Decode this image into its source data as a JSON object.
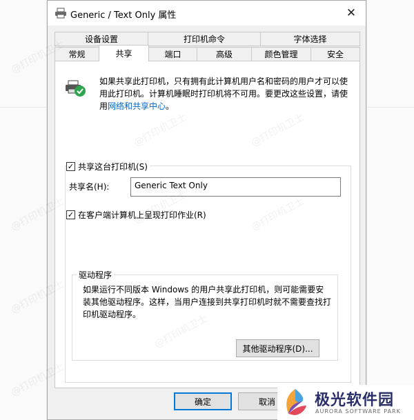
{
  "window": {
    "title": "Generic / Text Only 属性",
    "close_glyph": "✕"
  },
  "tabs": {
    "row1": [
      "设备设置",
      "打印机命令",
      "字体选择"
    ],
    "row2": [
      "常规",
      "共享",
      "端口",
      "高级",
      "颜色管理",
      "安全"
    ],
    "selected": "共享"
  },
  "share_tab": {
    "intro_text": "如果共享此打印机，只有拥有此计算机用户名和密码的用户才可以使用此打印机。计算机睡眠时打印机将不可用。要更改这些设置，请使用",
    "intro_link": "网络和共享中心",
    "intro_end": "。",
    "share_checkbox_label": "共享这台打印机(S)",
    "share_checked": true,
    "share_name_label": "共享名(H):",
    "share_name_value": "Generic  Text Only",
    "render_checkbox_label": "在客户端计算机上呈现打印作业(R)",
    "render_checked": true,
    "drivers_legend": "驱动程序",
    "drivers_text": "如果运行不同版本 Windows 的用户共享此打印机，则可能需要安装其他驱动程序。这样，当用户连接到共享打印机时就不需要查找打印机驱动程序。",
    "other_drivers_button": "其他驱动程序(D)..."
  },
  "footer": {
    "ok_label": "确定",
    "cancel_label": "取消"
  },
  "watermark_text": "@打印机卫士",
  "brand": {
    "name": "极光软件园",
    "subtitle": "AURORA SOFTWARE PARK"
  },
  "colors": {
    "dialog_bg": "#f0f0f0",
    "link": "#0066cc",
    "primary_border": "#0078d7",
    "brand_text": "#2a2f6a"
  },
  "icons": {
    "title": "printer-icon",
    "share": "shared-printer-icon",
    "check": "checkmark-icon"
  }
}
